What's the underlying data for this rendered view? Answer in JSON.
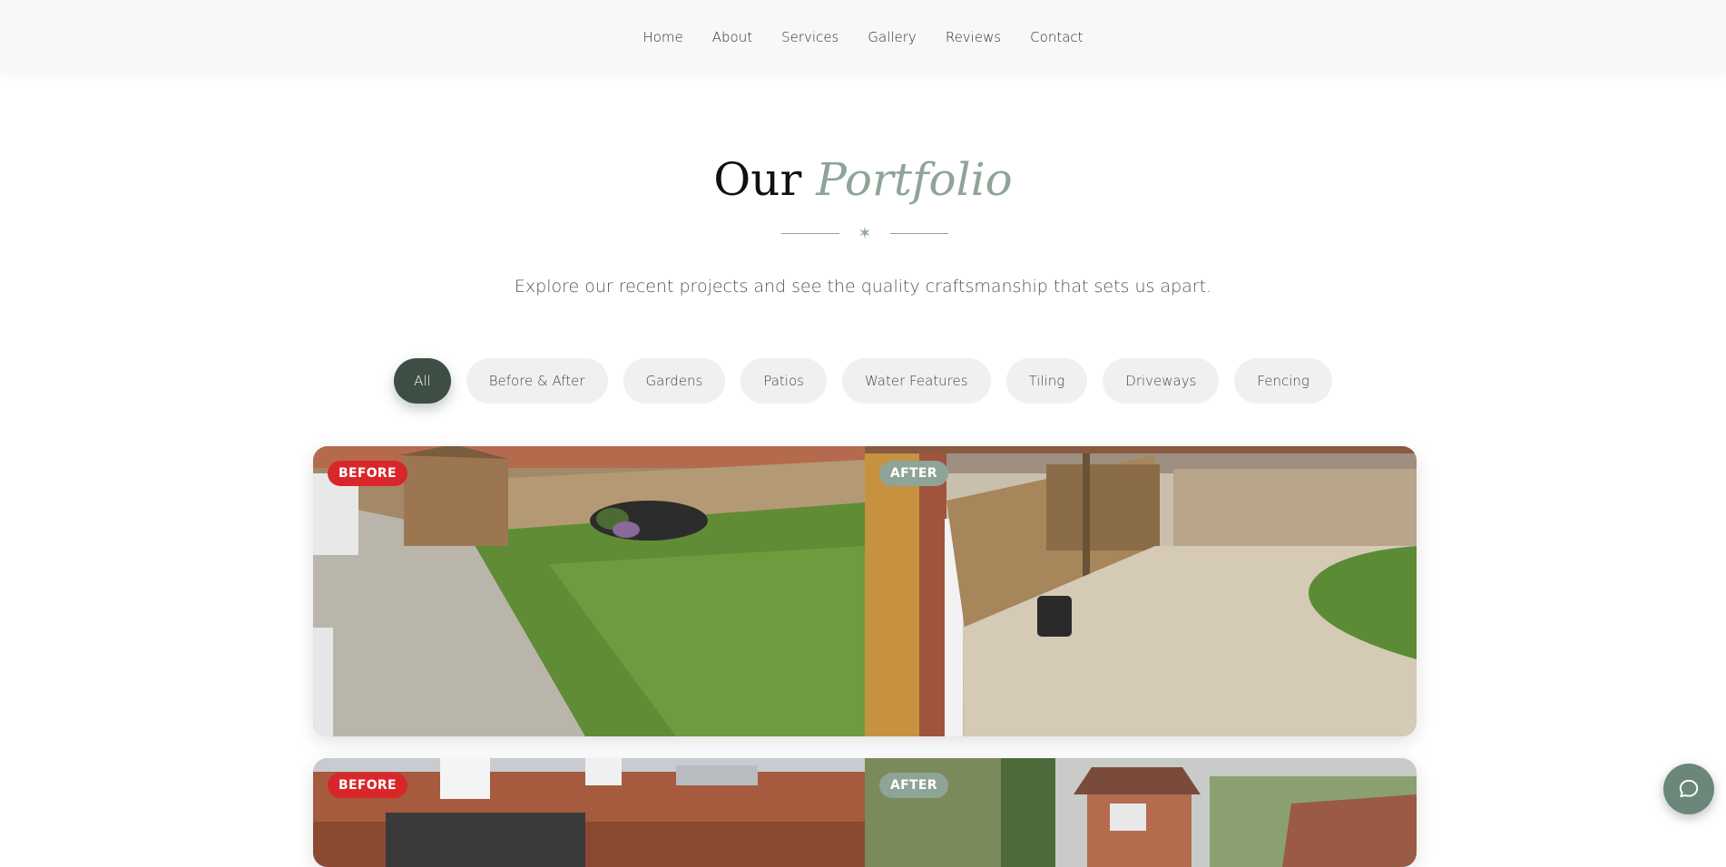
{
  "nav": {
    "items": [
      {
        "label": "Home"
      },
      {
        "label": "About"
      },
      {
        "label": "Services"
      },
      {
        "label": "Gallery"
      },
      {
        "label": "Reviews"
      },
      {
        "label": "Contact"
      }
    ]
  },
  "portfolio": {
    "title_plain": "Our",
    "title_accent": "Portfolio",
    "subtitle": "Explore our recent projects and see the quality craftsmanship that sets us apart."
  },
  "filters": {
    "items": [
      {
        "label": "All"
      },
      {
        "label": "Before & After"
      },
      {
        "label": "Gardens"
      },
      {
        "label": "Patios"
      },
      {
        "label": "Water Features"
      },
      {
        "label": "Tiling"
      },
      {
        "label": "Driveways"
      },
      {
        "label": "Fencing"
      }
    ],
    "selected": "All"
  },
  "gallery": {
    "projects": [
      {
        "before_label": "BEFORE",
        "after_label": "AFTER"
      },
      {
        "before_label": "BEFORE",
        "after_label": "AFTER"
      }
    ]
  },
  "chat": {
    "icon": "chat-bubble-icon"
  },
  "colors": {
    "accent": "#8ea497",
    "active_filter": "#3d4f45",
    "before_badge": "#d9262a",
    "after_badge": "#8ea497",
    "chat_button": "#6b877a"
  }
}
